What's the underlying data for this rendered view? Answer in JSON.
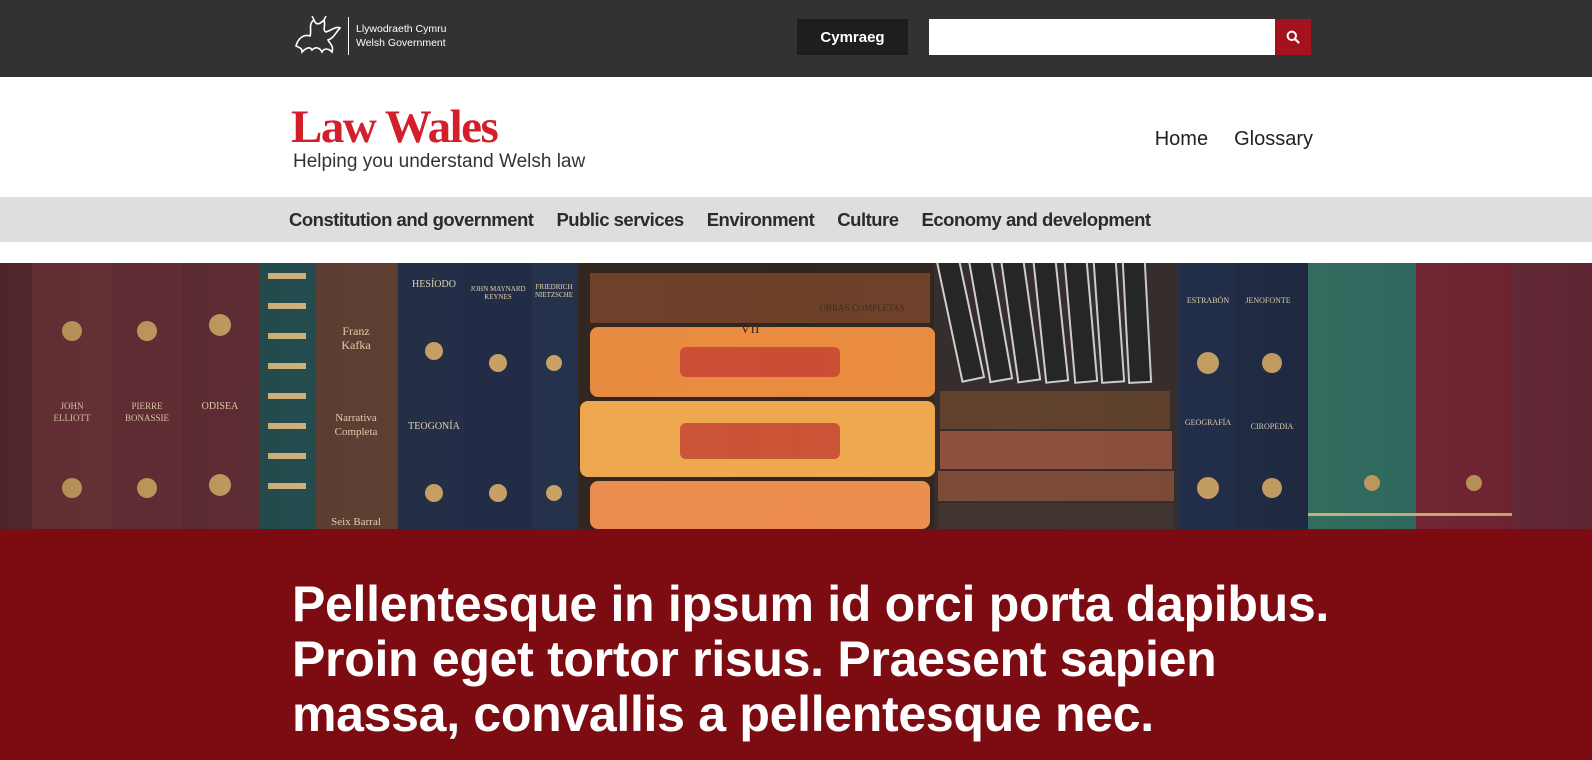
{
  "gov_bar": {
    "logo_line1": "Llywodraeth Cymru",
    "logo_line2": "Welsh Government",
    "language_button": "Cymraeg",
    "search_placeholder": "",
    "search_icon": "magnifier-icon"
  },
  "header": {
    "brand_name": "Law Wales",
    "tagline": "Helping you understand Welsh law",
    "links": [
      "Home",
      "Glossary"
    ]
  },
  "categories": [
    "Constitution and government",
    "Public services",
    "Environment",
    "Culture",
    "Economy and development"
  ],
  "hero": {
    "image": "bookshelf-photo",
    "spine_labels": [
      "JOHN ELLIOTT",
      "PIERRE BONASSIE",
      "ODISEA",
      "Franz Kafka",
      "Narrativa Completa",
      "Seix Barral",
      "HESÍODO",
      "TEOGONÍA",
      "JOHN MAYNARD KEYNES",
      "FRIEDRICH NIETZSCHE",
      "OBRAS COMPLETAS",
      "VII",
      "ESTRABÓN",
      "JENOFONTE",
      "GEOGRAFÍA",
      "CIROPEDIA"
    ]
  },
  "banner": {
    "text": "Pellentesque in ipsum id orci porta dapibus. Proin eget tortor risus. Praesent sapien massa, convallis a pellentesque nec."
  },
  "colors": {
    "gov_bar": "#323232",
    "brand_red": "#d21f2b",
    "search_button": "#a4121e",
    "banner": "#7d0b12",
    "nav_bg": "#dedede"
  }
}
